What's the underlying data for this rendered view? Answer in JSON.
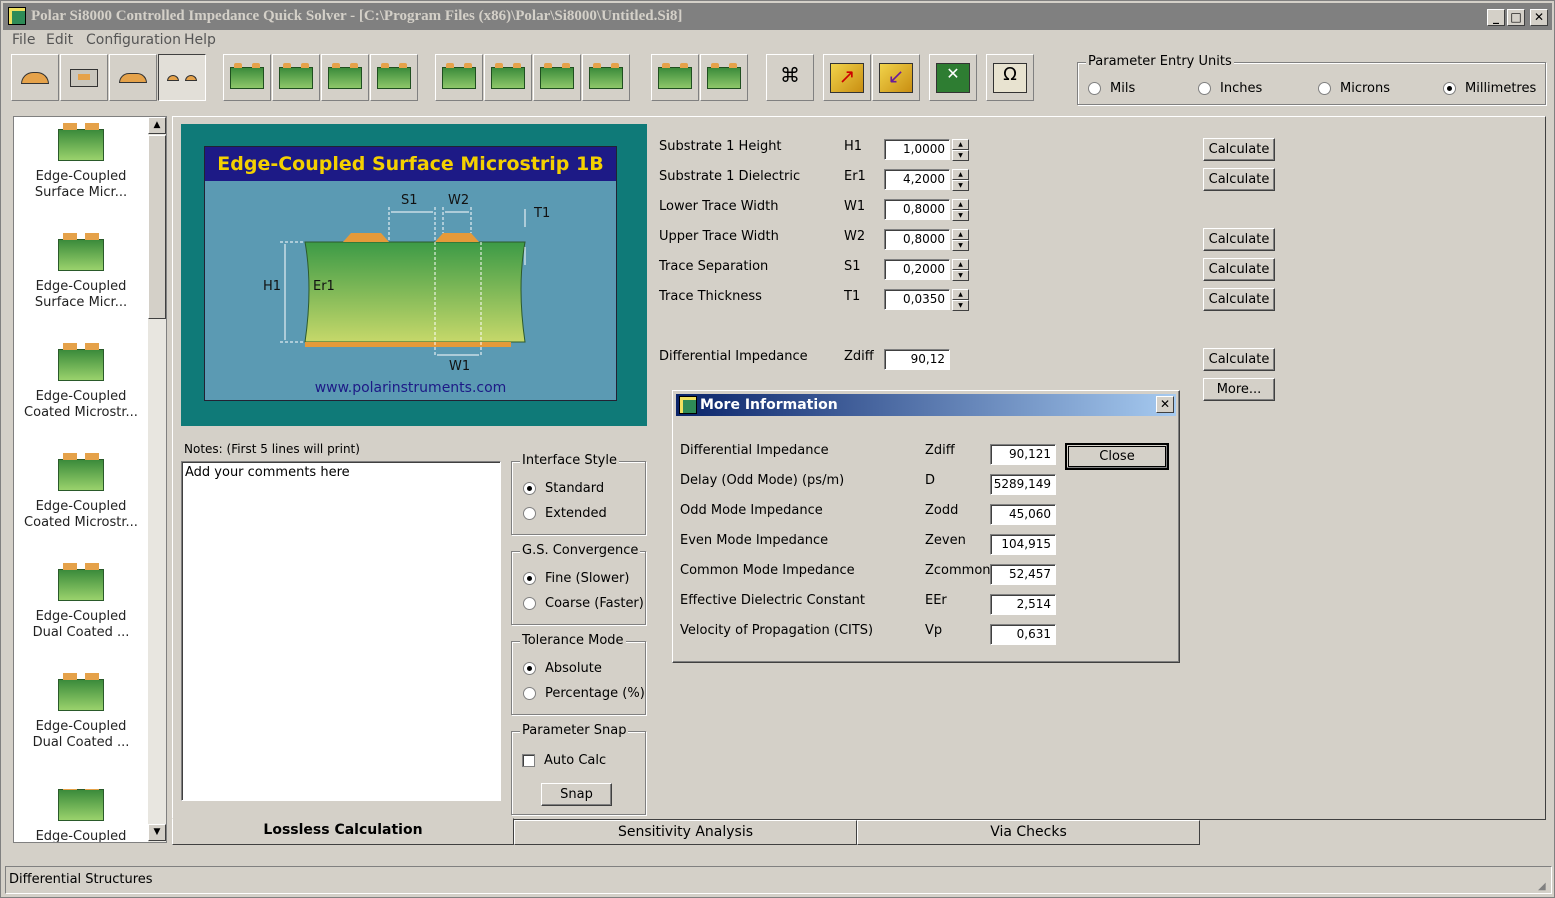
{
  "window": {
    "title": "Polar Si8000 Controlled Impedance Quick Solver - [C:\\Program Files (x86)\\Polar\\Si8000\\Untitled.Si8]",
    "min": "_",
    "max": "□",
    "close": "✕"
  },
  "menu": [
    "File",
    "Edit",
    "Configuration",
    "Help"
  ],
  "units": {
    "legend": "Parameter Entry Units",
    "options": [
      "Mils",
      "Inches",
      "Microns",
      "Millimetres"
    ],
    "selected": "Millimetres"
  },
  "sidebar": {
    "items": [
      {
        "line1": "Edge-Coupled",
        "line2": "Surface Micr..."
      },
      {
        "line1": "Edge-Coupled",
        "line2": "Surface Micr..."
      },
      {
        "line1": "Edge-Coupled",
        "line2": "Coated Microstr..."
      },
      {
        "line1": "Edge-Coupled",
        "line2": "Coated Microstr..."
      },
      {
        "line1": "Edge-Coupled",
        "line2": "Dual Coated ..."
      },
      {
        "line1": "Edge-Coupled",
        "line2": "Dual Coated ..."
      },
      {
        "line1": "Edge-Coupled",
        "line2": ""
      }
    ]
  },
  "diagram": {
    "title": "Edge-Coupled Surface Microstrip 1B",
    "url": "www.polarinstruments.com",
    "labels": {
      "s1": "S1",
      "w2": "W2",
      "t1": "T1",
      "h1": "H1",
      "er1": "Er1",
      "w1": "W1"
    }
  },
  "params": [
    {
      "label": "Substrate 1 Height",
      "sym": "H1",
      "value": "1,0000",
      "calc": "Calculate"
    },
    {
      "label": "Substrate 1 Dielectric",
      "sym": "Er1",
      "value": "4,2000",
      "calc": "Calculate"
    },
    {
      "label": "Lower Trace Width",
      "sym": "W1",
      "value": "0,8000",
      "calc": ""
    },
    {
      "label": "Upper Trace Width",
      "sym": "W2",
      "value": "0,8000",
      "calc": "Calculate"
    },
    {
      "label": "Trace Separation",
      "sym": "S1",
      "value": "0,2000",
      "calc": "Calculate"
    },
    {
      "label": "Trace Thickness",
      "sym": "T1",
      "value": "0,0350",
      "calc": "Calculate"
    }
  ],
  "result": {
    "label": "Differential Impedance",
    "sym": "Zdiff",
    "value": "90,12",
    "calc": "Calculate",
    "more": "More..."
  },
  "notes": {
    "label": "Notes: (First 5 lines will print)",
    "text": "Add your comments here"
  },
  "interface_style": {
    "legend": "Interface Style",
    "options": [
      "Standard",
      "Extended"
    ],
    "selected": "Standard"
  },
  "gs_convergence": {
    "legend": "G.S. Convergence",
    "options": [
      "Fine (Slower)",
      "Coarse (Faster)"
    ],
    "selected": "Fine (Slower)"
  },
  "tolerance_mode": {
    "legend": "Tolerance Mode",
    "options": [
      "Absolute",
      "Percentage (%)"
    ],
    "selected": "Absolute"
  },
  "param_snap": {
    "legend": "Parameter Snap",
    "auto_calc": "Auto Calc",
    "auto_checked": false,
    "snap": "Snap"
  },
  "tabs": [
    "Lossless Calculation",
    "Sensitivity Analysis",
    "Via Checks"
  ],
  "dialog": {
    "title": "More Information",
    "close": "Close",
    "x": "✕",
    "rows": [
      {
        "label": "Differential Impedance",
        "sym": "Zdiff",
        "value": "90,121"
      },
      {
        "label": "Delay (Odd Mode) (ps/m)",
        "sym": "D",
        "value": "5289,149"
      },
      {
        "label": "Odd Mode Impedance",
        "sym": "Zodd",
        "value": "45,060"
      },
      {
        "label": "Even Mode Impedance",
        "sym": "Zeven",
        "value": "104,915"
      },
      {
        "label": "Common Mode Impedance",
        "sym": "Zcommon",
        "value": "52,457"
      },
      {
        "label": "Effective Dielectric Constant",
        "sym": "EEr",
        "value": "2,514"
      },
      {
        "label": "Velocity of Propagation (CITS)",
        "sym": "Vp",
        "value": "0,631"
      }
    ]
  },
  "status": "Differential Structures"
}
